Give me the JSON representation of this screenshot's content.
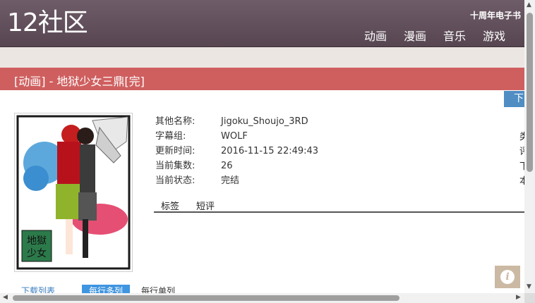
{
  "header": {
    "logo": "12社区",
    "anniversary": "十周年电子书",
    "nav": [
      "动画",
      "漫画",
      "音乐",
      "游戏"
    ]
  },
  "title": "[动画] - 地狱少女三鼎[完]",
  "download_button": "下",
  "info": {
    "rows": [
      {
        "key": "其他名称:",
        "value": "Jigoku_Shoujo_3RD"
      },
      {
        "key": "字幕组:",
        "value": "WOLF"
      },
      {
        "key": "更新时间:",
        "value": "2016-11-15 22:49:43"
      },
      {
        "key": "当前集数:",
        "value": "26"
      },
      {
        "key": "当前状态:",
        "value": "完结"
      }
    ],
    "right_partial": [
      "类",
      "评",
      "下",
      "本"
    ]
  },
  "tabs": [
    "标签",
    "短评"
  ],
  "bottom_tabs": [
    "下载列表",
    "每行多列",
    "每行单列"
  ],
  "poster_text": "地獄少女",
  "colors": {
    "header": "#5f4d59",
    "title_bar": "#cf5f5f",
    "accent_blue": "#4f8dc3"
  }
}
